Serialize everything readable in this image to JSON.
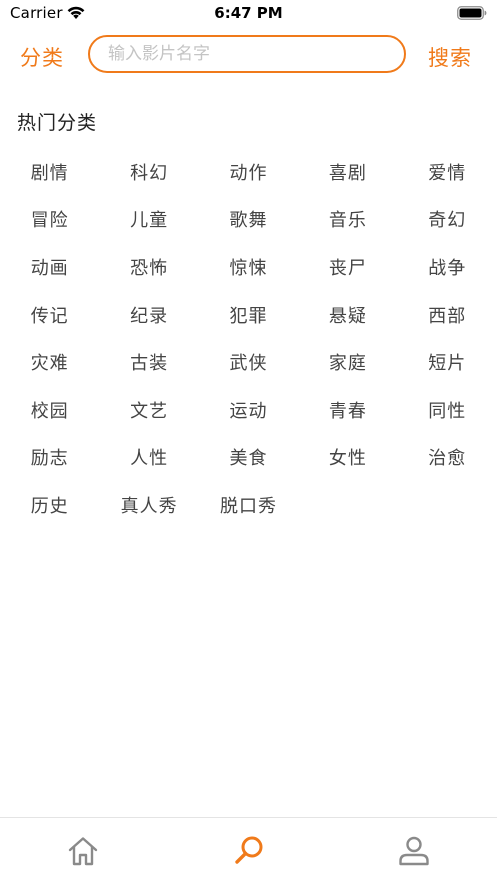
{
  "status_bar": {
    "carrier": "Carrier",
    "time": "6:47 PM",
    "wifi_icon": "wifi-icon",
    "battery_icon": "battery-icon"
  },
  "header": {
    "category_label": "分类",
    "search_placeholder": "输入影片名字",
    "search_value": "",
    "search_button_label": "搜索"
  },
  "hot": {
    "title": "热门分类",
    "categories": [
      "剧情",
      "科幻",
      "动作",
      "喜剧",
      "爱情",
      "冒险",
      "儿童",
      "歌舞",
      "音乐",
      "奇幻",
      "动画",
      "恐怖",
      "惊悚",
      "丧尸",
      "战争",
      "传记",
      "纪录",
      "犯罪",
      "悬疑",
      "西部",
      "灾难",
      "古装",
      "武侠",
      "家庭",
      "短片",
      "校园",
      "文艺",
      "运动",
      "青春",
      "同性",
      "励志",
      "人性",
      "美食",
      "女性",
      "治愈",
      "历史",
      "真人秀",
      "脱口秀"
    ]
  },
  "tabbar": {
    "tabs": [
      {
        "icon": "home-icon",
        "active": false
      },
      {
        "icon": "search-icon",
        "active": true
      },
      {
        "icon": "user-icon",
        "active": false
      }
    ],
    "colors": {
      "active": "#f07a1a",
      "inactive": "#8a8a8a"
    }
  },
  "colors": {
    "accent": "#f07a1a"
  }
}
